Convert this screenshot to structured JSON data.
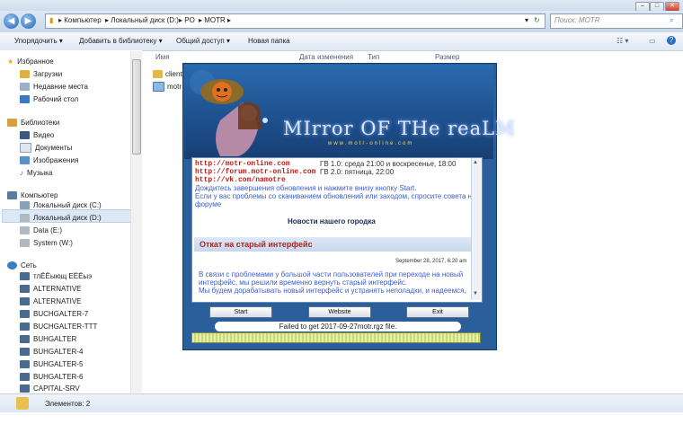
{
  "window": {
    "minimize": "–",
    "maximize": "□",
    "close": "✕"
  },
  "address": {
    "crumbs": [
      "Компьютер",
      "Локальный диск (D:)",
      "PO",
      "MOTR"
    ],
    "search_placeholder": "Поиск: MOTR"
  },
  "toolbar": {
    "organize": "Упорядочить ▾",
    "library": "Добавить в библиотеку ▾",
    "share": "Общий доступ ▾",
    "new_folder": "Новая папка"
  },
  "nav": {
    "favorites": "Избранное",
    "fav_items": [
      "Загрузки",
      "Недавние места",
      "Рабочий стол"
    ],
    "libraries": "Библиотеки",
    "lib_items": [
      "Видео",
      "Документы",
      "Изображения",
      "Музыка"
    ],
    "computer": "Компьютер",
    "drives": [
      "Локальный диск (C:)",
      "Локальный диск (D:)",
      "Data (E:)",
      "System (W:)"
    ],
    "network": "Сеть",
    "net_items": [
      "тлЁЁыющ ЕЁЁыэ",
      "ALTERNATIVE",
      "ALTERNATIVE",
      "BUCHGALTER-7",
      "BUCHGALTER-TTT",
      "BUHGALTER",
      "BUHGALTER-4",
      "BUHGALTER-5",
      "BUHGALTER-6",
      "CAPITAL-SRV"
    ]
  },
  "columns": {
    "name": "Имя",
    "date": "Дата изменения",
    "type": "Тип",
    "size": "Размер"
  },
  "files": [
    "client",
    "motr"
  ],
  "status": {
    "count": "Элементов: 2"
  },
  "launcher": {
    "logo": "MIrror OF THe reaLM",
    "logo_sub": "www.motr-online.com",
    "link1": "http://motr-online.com",
    "link2": "http://forum.motr-online.com",
    "link3": "http://vk.com/namotre",
    "gv1": "ГВ 1.0: среда 21:00 и воскресенье, 18:00",
    "gv2": "ГВ 2.0: пятница, 22:00",
    "info1": "Дождитесь завершения обновления и нажмите внизу кнопку Start.",
    "info2": "Если у вас проблемы со скачиванием обновлений или заходом, спросите совета на",
    "info3": "форуме",
    "news_header": "Новости нашего городка",
    "news_title": "Откат на старый интерфейс",
    "news_date": "September 28, 2017, 6:20 am",
    "news_p1": "В связи с проблемами у большой части пользователей при переходе на новый",
    "news_p2": "интерфейс, мы решили временно вернуть старый интерфейс.",
    "news_p3": "Мы будем дорабатывать новый интерфейс и устранять неполадки, и надеемся,",
    "btn_start": "Start",
    "btn_website": "Website",
    "btn_exit": "Exit",
    "status_text": "Failed to get 2017-09-27motr.rgz file."
  }
}
